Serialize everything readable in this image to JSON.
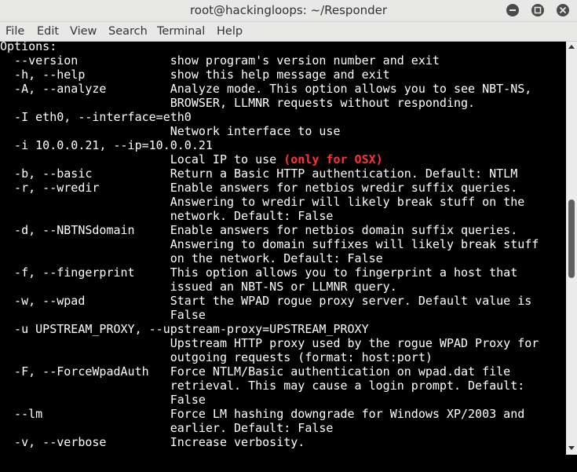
{
  "window": {
    "title": "root@hackingloops: ~/Responder",
    "controls": [
      "minimize-icon",
      "maximize-icon",
      "close-icon"
    ]
  },
  "menu": {
    "items": [
      "File",
      "Edit",
      "View",
      "Search",
      "Terminal",
      "Help"
    ]
  },
  "terminal": {
    "lines": [
      "Options:",
      "  --version             show program's version number and exit",
      "  -h, --help            show this help message and exit",
      "  -A, --analyze         Analyze mode. This option allows you to see NBT-NS,",
      "                        BROWSER, LLMNR requests without responding.",
      "  -I eth0, --interface=eth0",
      "                        Network interface to use",
      "  -i 10.0.0.21, --ip=10.0.0.21",
      "                        Local IP to use ",
      "  -b, --basic           Return a Basic HTTP authentication. Default: NTLM",
      "  -r, --wredir          Enable answers for netbios wredir suffix queries.",
      "                        Answering to wredir will likely break stuff on the",
      "                        network. Default: False",
      "  -d, --NBTNSdomain     Enable answers for netbios domain suffix queries.",
      "                        Answering to domain suffixes will likely break stuff",
      "                        on the network. Default: False",
      "  -f, --fingerprint     This option allows you to fingerprint a host that",
      "                        issued an NBT-NS or LLMNR query.",
      "  -w, --wpad            Start the WPAD rogue proxy server. Default value is",
      "                        False",
      "  -u UPSTREAM_PROXY, --upstream-proxy=UPSTREAM_PROXY",
      "                        Upstream HTTP proxy used by the rogue WPAD Proxy for",
      "                        outgoing requests (format: host:port)",
      "  -F, --ForceWpadAuth   Force NTLM/Basic authentication on wpad.dat file",
      "                        retrieval. This may cause a login prompt. Default:",
      "                        False",
      "  --lm                  Force LM hashing downgrade for Windows XP/2003 and",
      "                        earlier. Default: False",
      "  -v, --verbose         Increase verbosity."
    ],
    "highlight": "(only for OSX)",
    "colors": {
      "background": "#000000",
      "text": "#ffffff",
      "highlight": "#ff3333"
    }
  },
  "scrollbar": {
    "position_fraction": 0.47
  }
}
